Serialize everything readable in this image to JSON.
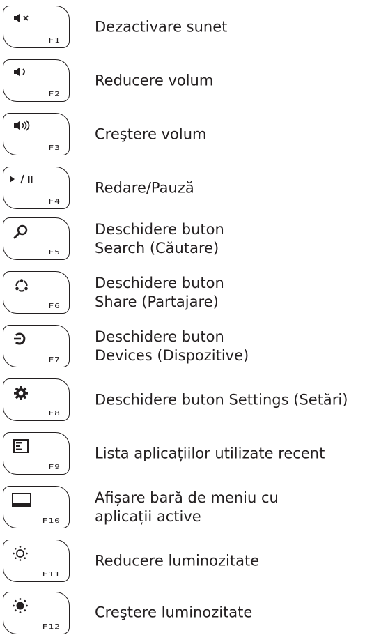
{
  "rows": [
    {
      "key": "F1",
      "icon": "speaker-muted-icon",
      "line1": "Dezactivare sunet",
      "line2": ""
    },
    {
      "key": "F2",
      "icon": "volume-low-icon",
      "line1": "Reducere volum",
      "line2": ""
    },
    {
      "key": "F3",
      "icon": "volume-high-icon",
      "line1": "Creştere volum",
      "line2": ""
    },
    {
      "key": "F4",
      "icon": "play-pause-icon",
      "line1": "Redare/Pauză",
      "line2": ""
    },
    {
      "key": "F5",
      "icon": "search-icon",
      "line1": "Deschidere buton",
      "line2": "Search (Căutare)"
    },
    {
      "key": "F6",
      "icon": "share-icon",
      "line1": "Deschidere buton",
      "line2": "Share (Partajare)"
    },
    {
      "key": "F7",
      "icon": "devices-icon",
      "line1": "Deschidere buton",
      "line2": "Devices (Dispozitive)"
    },
    {
      "key": "F8",
      "icon": "gear-icon",
      "line1": "Deschidere buton Settings (Setări)",
      "line2": ""
    },
    {
      "key": "F9",
      "icon": "recent-apps-icon",
      "line1": "Lista aplicațiilor utilizate recent",
      "line2": ""
    },
    {
      "key": "F10",
      "icon": "app-bar-icon",
      "line1": "Afișare bară de meniu cu",
      "line2": "aplicații active"
    },
    {
      "key": "F11",
      "icon": "brightness-down-icon",
      "line1": "Reducere luminozitate",
      "line2": ""
    },
    {
      "key": "F12",
      "icon": "brightness-up-icon",
      "line1": "Creştere luminozitate",
      "line2": ""
    }
  ]
}
